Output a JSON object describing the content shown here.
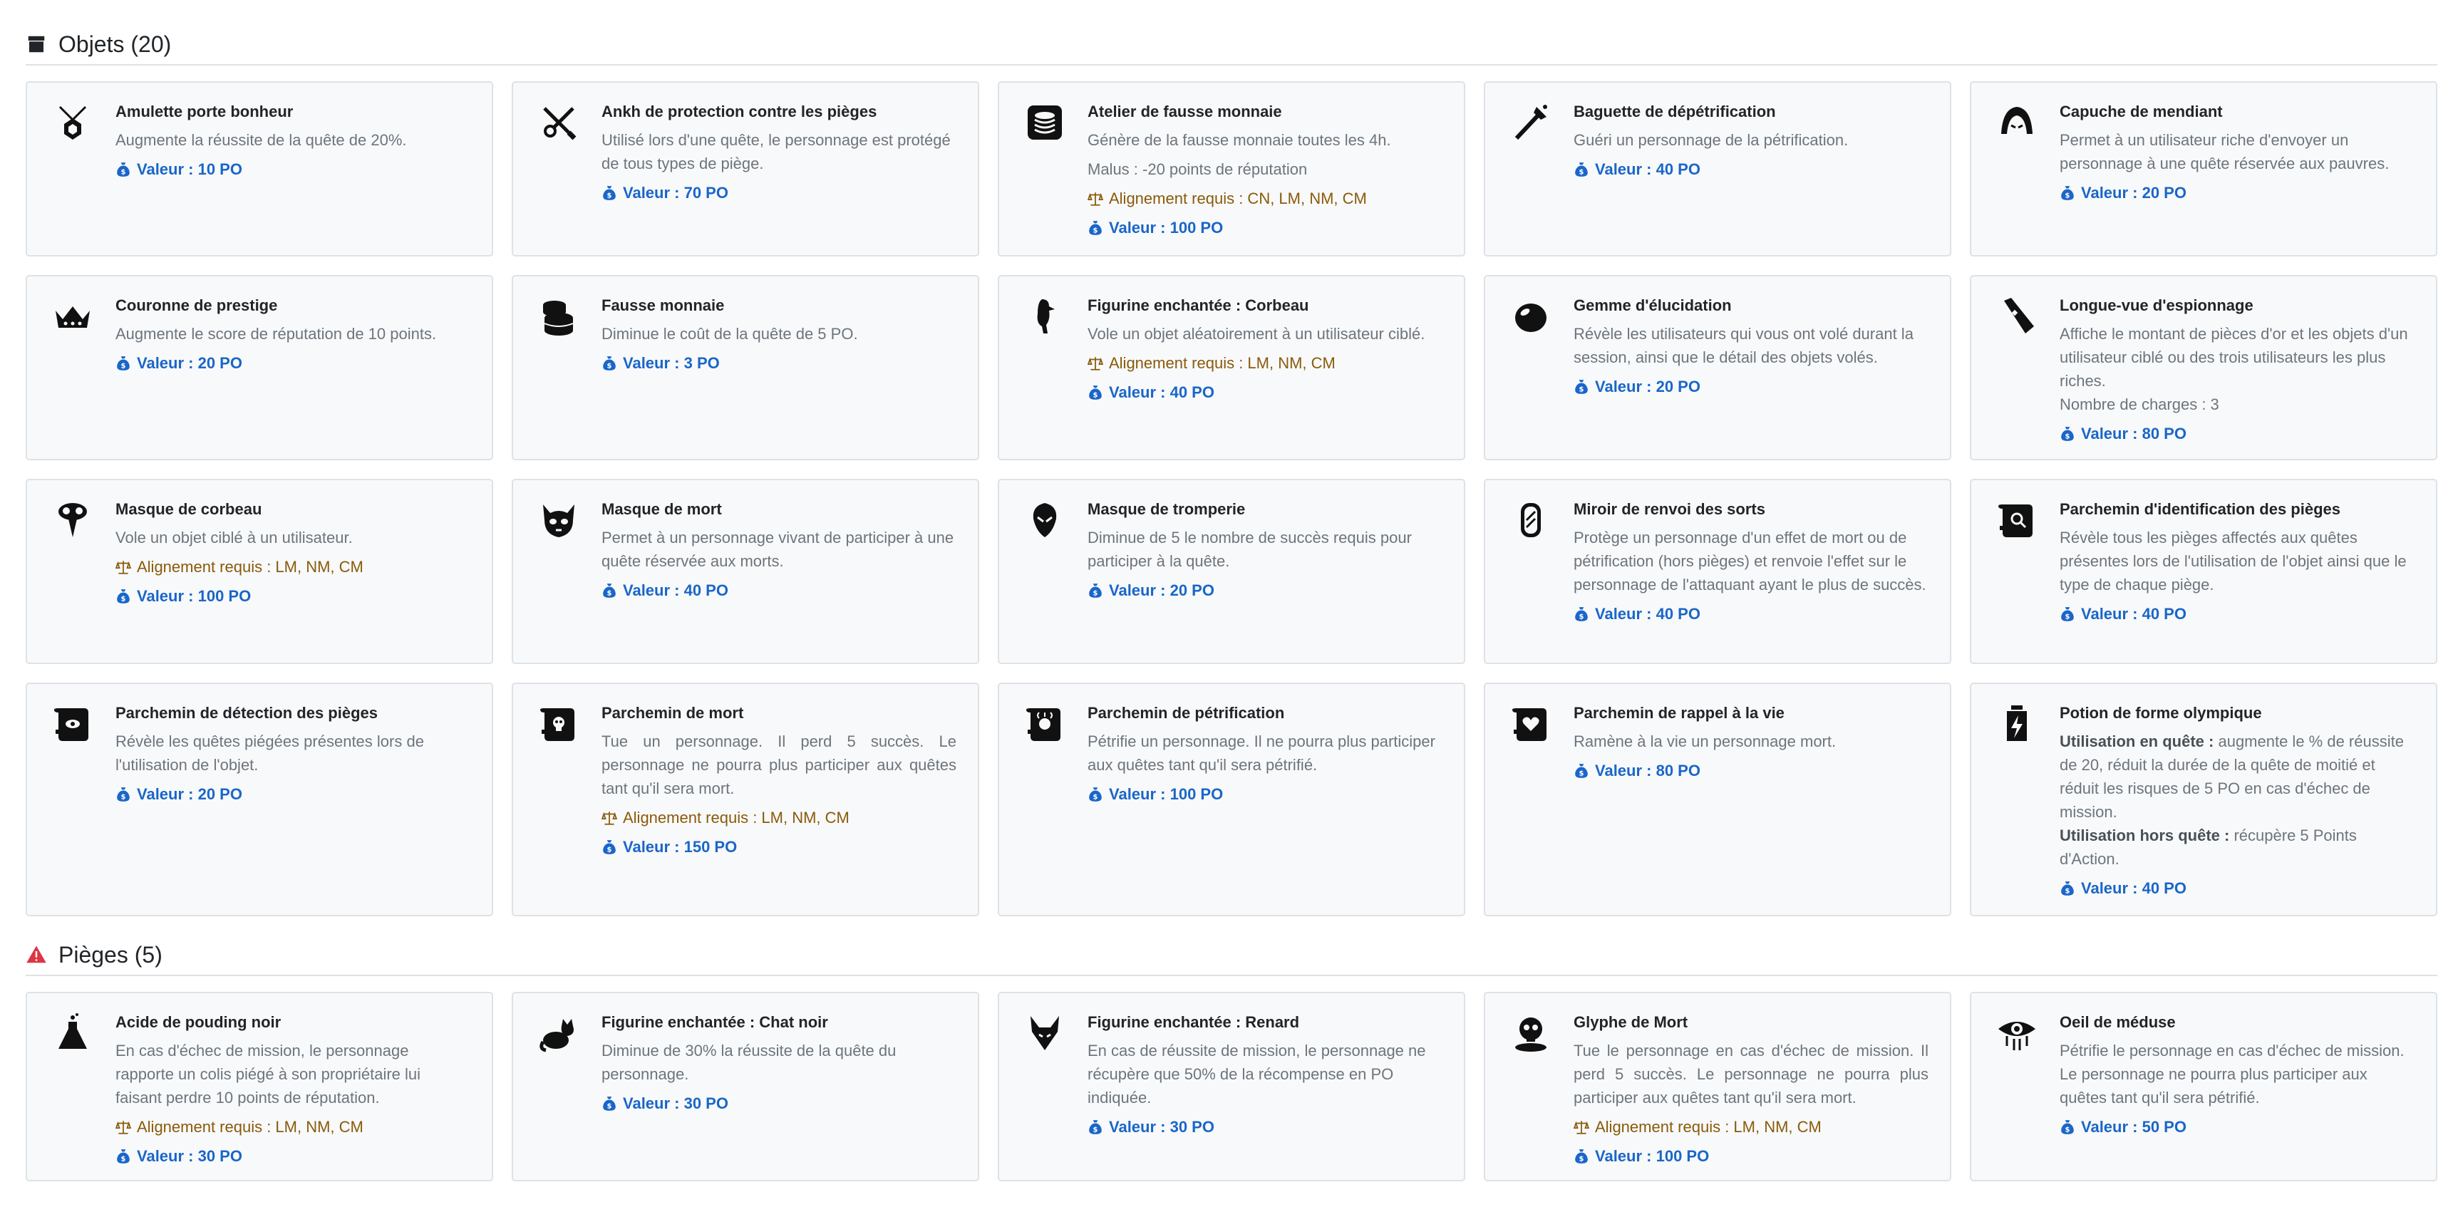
{
  "sections": {
    "objets": {
      "title": "Objets (20)"
    },
    "pieges": {
      "title": "Pièges (5)"
    }
  },
  "cards": [
    {
      "title": "Amulette porte bonheur",
      "desc": [
        "Augmente la réussite de la quête de 20%."
      ],
      "value": "Valeur : 10 PO"
    },
    {
      "title": "Ankh de protection contre les pièges",
      "desc": [
        "Utilisé lors d'une quête, le personnage est protégé de tous types de piège."
      ],
      "value": "Valeur : 70 PO"
    },
    {
      "title": "Atelier de fausse monnaie",
      "desc": [
        "Génère de la fausse monnaie toutes les 4h.",
        "Malus : -20 points de réputation"
      ],
      "align": "Alignement requis : CN, LM, NM, CM",
      "value": "Valeur : 100 PO"
    },
    {
      "title": "Baguette de dépétrification",
      "desc": [
        "Guéri un personnage de la pétrification."
      ],
      "value": "Valeur : 40 PO"
    },
    {
      "title": "Capuche de mendiant",
      "desc": [
        "Permet à un utilisateur riche d'envoyer un personnage à une quête réservée aux pauvres."
      ],
      "value": "Valeur : 20 PO"
    },
    {
      "title": "Couronne de prestige",
      "desc": [
        "Augmente le score de réputation de 10 points."
      ],
      "value": "Valeur : 20 PO"
    },
    {
      "title": "Fausse monnaie",
      "desc": [
        "Diminue le coût de la quête de 5 PO."
      ],
      "value": "Valeur : 3 PO"
    },
    {
      "title": "Figurine enchantée : Corbeau",
      "desc": [
        "Vole un objet aléatoirement à un utilisateur ciblé."
      ],
      "align": "Alignement requis : LM, NM, CM",
      "value": "Valeur : 40 PO"
    },
    {
      "title": "Gemme d'élucidation",
      "desc": [
        "Révèle les utilisateurs qui vous ont volé durant la session, ainsi que le détail des objets volés."
      ],
      "value": "Valeur : 20 PO"
    },
    {
      "title": "Longue-vue d'espionnage",
      "desc": [
        "Affiche le montant de pièces d'or et les objets d'un utilisateur ciblé ou des trois utilisateurs les plus riches.",
        "Nombre de charges : 3"
      ],
      "value": "Valeur : 80 PO"
    },
    {
      "title": "Masque de corbeau",
      "desc": [
        "Vole un objet ciblé à un utilisateur."
      ],
      "align": "Alignement requis : LM, NM, CM",
      "value": "Valeur : 100 PO"
    },
    {
      "title": "Masque de mort",
      "desc": [
        "Permet à un personnage vivant de participer à une quête réservée aux morts."
      ],
      "value": "Valeur : 40 PO"
    },
    {
      "title": "Masque de tromperie",
      "desc": [
        "Diminue de 5 le nombre de succès requis pour participer à la quête."
      ],
      "value": "Valeur : 20 PO"
    },
    {
      "title": "Miroir de renvoi des sorts",
      "desc": [
        "Protège un personnage d'un effet de mort ou de pétrification (hors pièges) et renvoie l'effet sur le personnage de l'attaquant ayant le plus de succès."
      ],
      "value": "Valeur : 40 PO"
    },
    {
      "title": "Parchemin d'identification des pièges",
      "desc": [
        "Révèle tous les pièges affectés aux quêtes présentes lors de l'utilisation de l'objet ainsi que le type de chaque piège."
      ],
      "value": "Valeur : 40 PO"
    },
    {
      "title": "Parchemin de détection des pièges",
      "desc": [
        "Révèle les quêtes piégées présentes lors de l'utilisation de l'objet."
      ],
      "value": "Valeur : 20 PO"
    },
    {
      "title": "Parchemin de mort",
      "desc": [
        "Tue un personnage. Il perd 5 succès. Le personnage ne pourra plus participer aux quêtes tant qu'il sera mort."
      ],
      "justify": true,
      "align": "Alignement requis : LM, NM, CM",
      "value": "Valeur : 150 PO"
    },
    {
      "title": "Parchemin de pétrification",
      "desc": [
        "Pétrifie un personnage. Il ne pourra plus participer aux quêtes tant qu'il sera pétrifié."
      ],
      "value": "Valeur : 100 PO"
    },
    {
      "title": "Parchemin de rappel à la vie",
      "desc": [
        "Ramène à la vie un personnage mort."
      ],
      "value": "Valeur : 80 PO"
    },
    {
      "title": "Potion de forme olympique",
      "desc_rich": [
        {
          "label": "Utilisation en quête :",
          "text": " augmente le % de réussite de 20, réduit la durée de la quête de moitié et réduit les risques de 5 PO en cas d'échec de mission."
        },
        {
          "label": "Utilisation hors quête :",
          "text": " récupère 5 Points d'Action."
        }
      ],
      "value": "Valeur : 40 PO"
    },
    {
      "title": "Acide de pouding noir",
      "desc": [
        "En cas d'échec de mission, le personnage rapporte un colis piégé à son propriétaire lui faisant perdre 10 points de réputation."
      ],
      "align": "Alignement requis : LM, NM, CM",
      "value": "Valeur : 30 PO"
    },
    {
      "title": "Figurine enchantée : Chat noir",
      "desc": [
        "Diminue de 30% la réussite de la quête du personnage."
      ],
      "value": "Valeur : 30 PO"
    },
    {
      "title": "Figurine enchantée : Renard",
      "desc": [
        "En cas de réussite de mission, le personnage ne récupère que 50% de la récompense en PO indiquée."
      ],
      "value": "Valeur : 30 PO"
    },
    {
      "title": "Glyphe de Mort",
      "desc": [
        "Tue le personnage en cas d'échec de mission. Il perd 5 succès. Le personnage ne pourra plus participer aux quêtes tant qu'il sera mort."
      ],
      "justify": true,
      "align": "Alignement requis : LM, NM, CM",
      "value": "Valeur : 100 PO"
    },
    {
      "title": "Oeil de méduse",
      "desc": [
        "Pétrifie le personnage en cas d'échec de mission. Le personnage ne pourra plus participer aux quêtes tant qu'il sera pétrifié."
      ],
      "value": "Valeur : 50 PO"
    }
  ],
  "colors": {
    "value": "#1a66c9",
    "align": "#8a5a0a",
    "danger": "#dc3545"
  }
}
